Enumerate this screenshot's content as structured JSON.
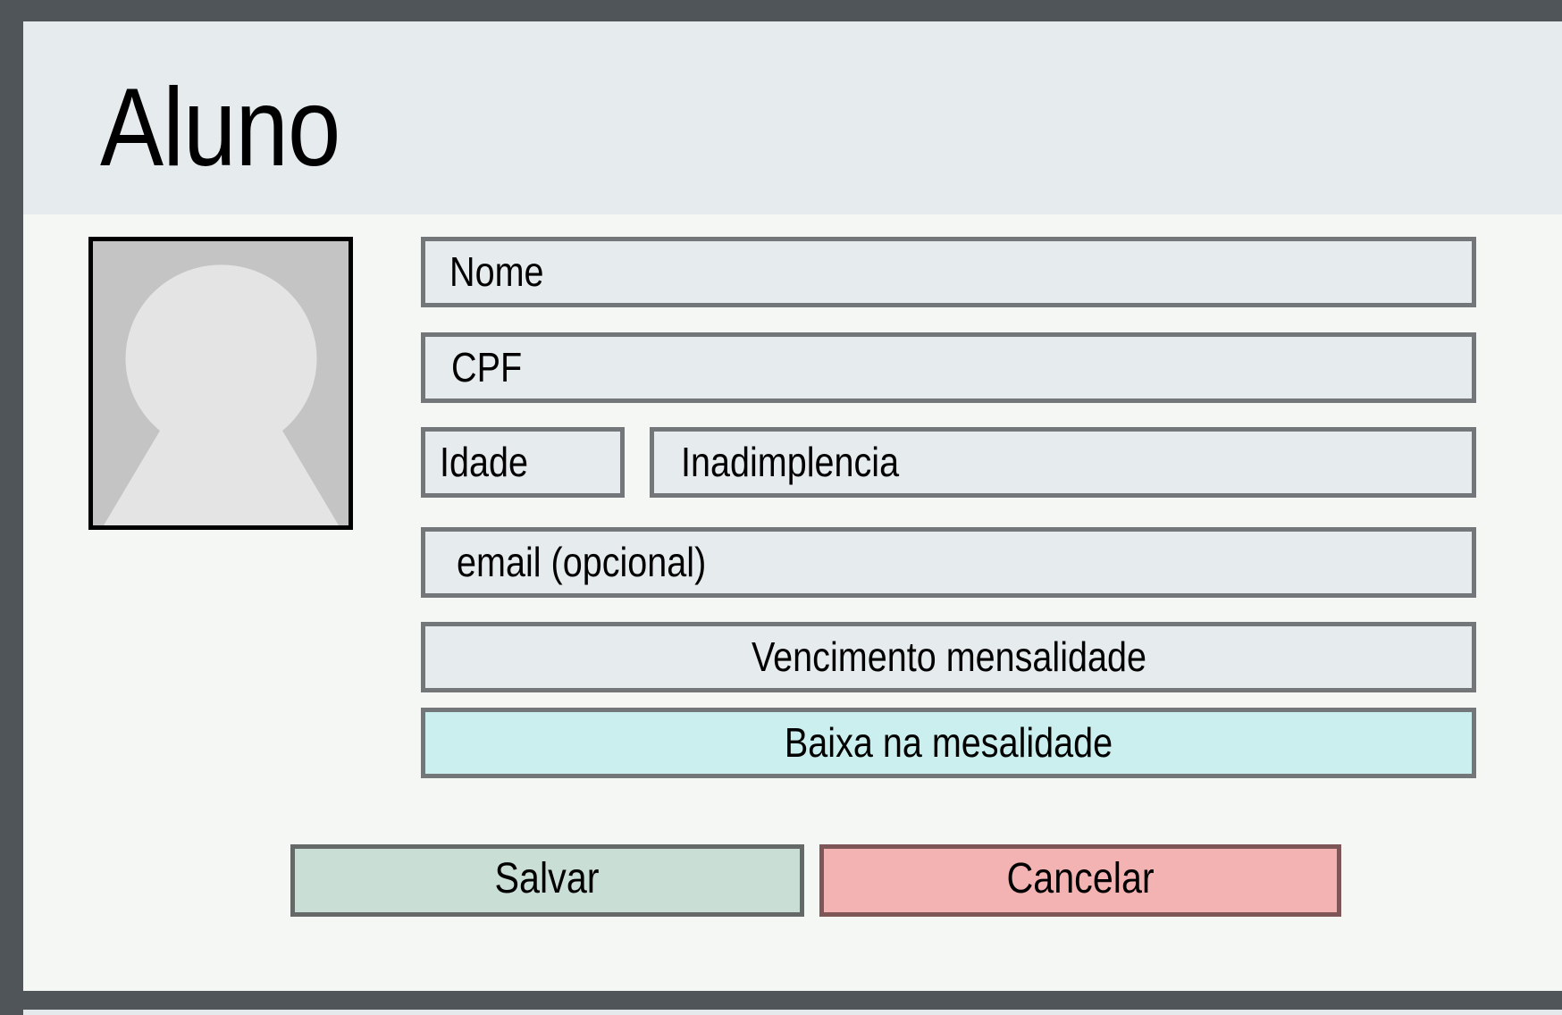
{
  "header": {
    "title": "Aluno"
  },
  "form": {
    "name_label": "Nome",
    "cpf_label": "CPF",
    "age_label": "Idade",
    "default_label": "Inadimplencia",
    "email_label": "email (opcional)",
    "due_date_label": "Vencimento mensalidade",
    "payment_label": "Baixa na mesalidade"
  },
  "actions": {
    "save_label": "Salvar",
    "cancel_label": "Cancelar"
  },
  "colors": {
    "payment_field": "#cbeeee",
    "save_button": "#c9ded4",
    "cancel_button": "#f4b3b3"
  },
  "icons": {
    "avatar": "user-placeholder-icon"
  }
}
